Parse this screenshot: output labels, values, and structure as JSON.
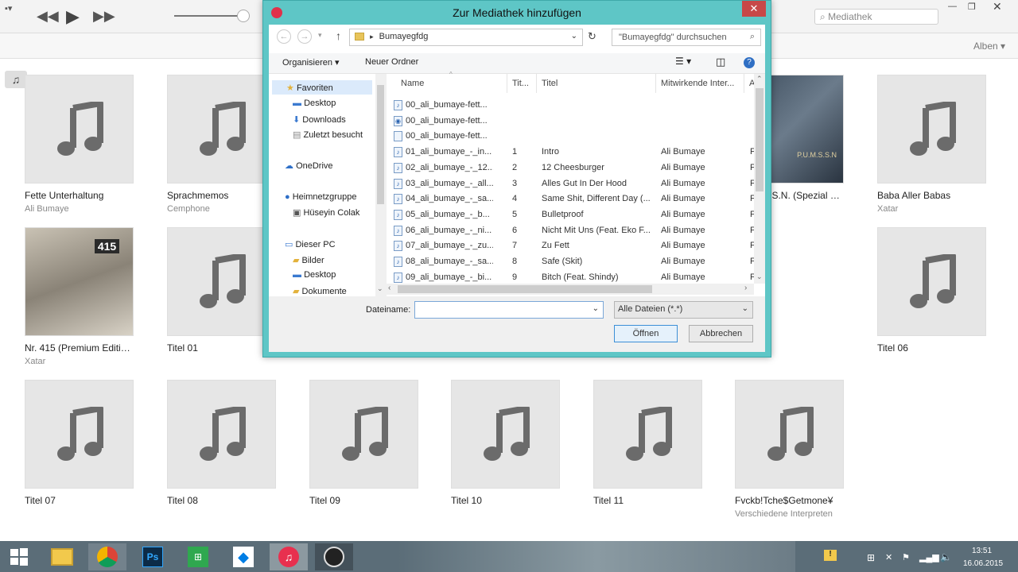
{
  "itunes": {
    "search_placeholder": "Mediathek",
    "view_selector": "Alben",
    "more_label": "•••"
  },
  "albums": [
    {
      "title": "Fette Unterhaltung",
      "artist": "Ali Bumaye"
    },
    {
      "title": "Sprachmemos",
      "artist": "Cemphone"
    },
    {
      "title": "P.U.M.S.S.N. (Spezial Ed...",
      "artist": ""
    },
    {
      "title": "Baba Aller Babas",
      "artist": "Xatar"
    },
    {
      "title": "Nr. 415 (Premium Edition)",
      "artist": "Xatar"
    },
    {
      "title": "Titel 01",
      "artist": ""
    },
    {
      "title": "Titel 06",
      "artist": ""
    },
    {
      "title": "Titel 07",
      "artist": ""
    },
    {
      "title": "Titel 08",
      "artist": ""
    },
    {
      "title": "Titel 09",
      "artist": ""
    },
    {
      "title": "Titel 10",
      "artist": ""
    },
    {
      "title": "Titel 11",
      "artist": ""
    },
    {
      "title": "Fvckb!Tche$Getmone¥",
      "artist": "Verschiedene Interpreten"
    }
  ],
  "dialog": {
    "title": "Zur Mediathek hinzufügen",
    "address": "Bumayegfdg",
    "search_placeholder": "\"Bumayegfdg\" durchsuchen",
    "organize": "Organisieren",
    "new_folder": "Neuer Ordner",
    "nav": {
      "favorites": "Favoriten",
      "desktop": "Desktop",
      "downloads": "Downloads",
      "recent": "Zuletzt besucht",
      "onedrive": "OneDrive",
      "homegroup": "Heimnetzgruppe",
      "user": "Hüseyin Colak",
      "thispc": "Dieser PC",
      "pictures": "Bilder",
      "pc_desktop": "Desktop",
      "documents": "Dokumente"
    },
    "columns": {
      "name": "Name",
      "track": "Tit...",
      "title": "Titel",
      "artist": "Mitwirkende Inter...",
      "extra": "A"
    },
    "files": [
      {
        "name": "00_ali_bumaye-fett...",
        "track": "",
        "title": "",
        "artist": "",
        "extra": ""
      },
      {
        "name": "00_ali_bumaye-fett...",
        "track": "",
        "title": "",
        "artist": "",
        "extra": ""
      },
      {
        "name": "00_ali_bumaye-fett...",
        "track": "",
        "title": "",
        "artist": "",
        "extra": ""
      },
      {
        "name": "01_ali_bumaye_-_in...",
        "track": "1",
        "title": "Intro",
        "artist": "Ali Bumaye",
        "extra": "F"
      },
      {
        "name": "02_ali_bumaye_-_12...",
        "track": "2",
        "title": "12 Cheesburger",
        "artist": "Ali Bumaye",
        "extra": "F"
      },
      {
        "name": "03_ali_bumaye_-_all...",
        "track": "3",
        "title": "Alles Gut In Der Hood",
        "artist": "Ali Bumaye",
        "extra": "F"
      },
      {
        "name": "04_ali_bumaye_-_sa...",
        "track": "4",
        "title": "Same Shit, Different Day (...",
        "artist": "Ali Bumaye",
        "extra": "F"
      },
      {
        "name": "05_ali_bumaye_-_b...",
        "track": "5",
        "title": "Bulletproof",
        "artist": "Ali Bumaye",
        "extra": "F"
      },
      {
        "name": "06_ali_bumaye_-_ni...",
        "track": "6",
        "title": "Nicht Mit Uns (Feat. Eko F...",
        "artist": "Ali Bumaye",
        "extra": "F"
      },
      {
        "name": "07_ali_bumaye_-_zu...",
        "track": "7",
        "title": "Zu Fett",
        "artist": "Ali Bumaye",
        "extra": "F"
      },
      {
        "name": "08_ali_bumaye_-_sa...",
        "track": "8",
        "title": "Safe (Skit)",
        "artist": "Ali Bumaye",
        "extra": "F"
      },
      {
        "name": "09_ali_bumaye_-_bi...",
        "track": "9",
        "title": "Bitch (Feat. Shindy)",
        "artist": "Ali Bumaye",
        "extra": "F"
      }
    ],
    "filename_label": "Dateiname:",
    "filename_value": "",
    "filetype": "Alle Dateien (*.*)",
    "open": "Öffnen",
    "cancel": "Abbrechen"
  },
  "taskbar": {
    "time": "13:51",
    "date": "16.06.2015"
  }
}
